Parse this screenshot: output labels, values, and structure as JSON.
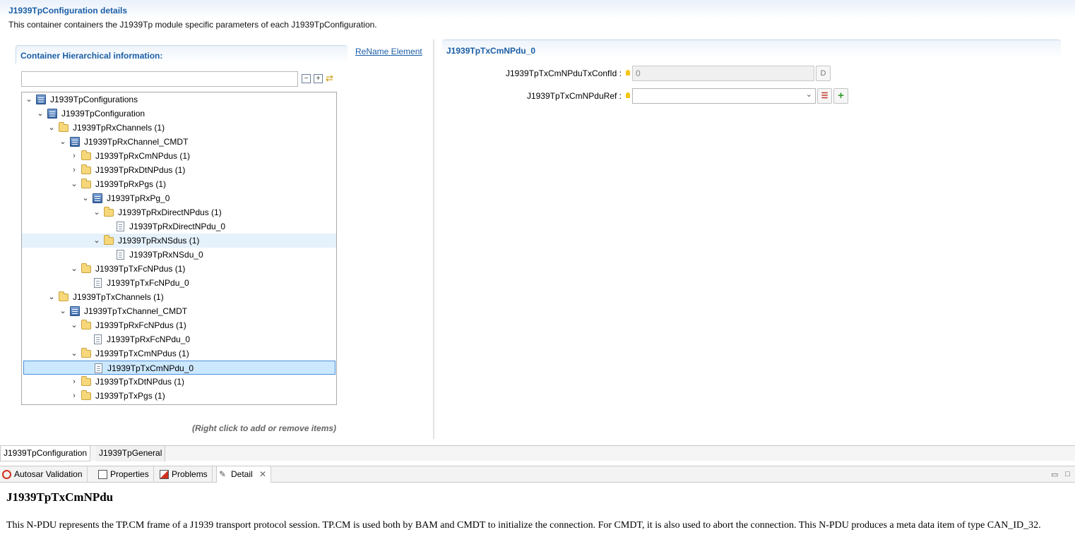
{
  "header": {
    "title": "J1939TpConfiguration details",
    "description": "This container containers the J1939Tp module specific parameters of each J1939TpConfiguration."
  },
  "left_panel": {
    "title": "Container Hierarchical information:",
    "rename_link": "ReName Element",
    "filter_value": "",
    "hint": "(Right click to add or remove items)"
  },
  "tree": [
    {
      "label": "J1939TpConfigurations",
      "icon": "config-icon",
      "twisty": "expanded"
    },
    {
      "label": "J1939TpConfiguration",
      "icon": "config-icon",
      "twisty": "expanded"
    },
    {
      "label": "J1939TpRxChannels (1)",
      "icon": "folder-icon",
      "twisty": "expanded"
    },
    {
      "label": "J1939TpRxChannel_CMDT",
      "icon": "config-icon",
      "twisty": "expanded"
    },
    {
      "label": "J1939TpRxCmNPdus (1)",
      "icon": "folder-icon",
      "twisty": "collapsed"
    },
    {
      "label": "J1939TpRxDtNPdus (1)",
      "icon": "folder-icon",
      "twisty": "collapsed"
    },
    {
      "label": "J1939TpRxPgs (1)",
      "icon": "folder-icon",
      "twisty": "expanded"
    },
    {
      "label": "J1939TpRxPg_0",
      "icon": "config-icon",
      "twisty": "expanded"
    },
    {
      "label": "J1939TpRxDirectNPdus (1)",
      "icon": "folder-icon",
      "twisty": "expanded"
    },
    {
      "label": "J1939TpRxDirectNPdu_0",
      "icon": "document-icon",
      "twisty": "none"
    },
    {
      "label": "J1939TpRxNSdus (1)",
      "icon": "folder-icon",
      "twisty": "expanded"
    },
    {
      "label": "J1939TpRxNSdu_0",
      "icon": "document-icon",
      "twisty": "none"
    },
    {
      "label": "J1939TpTxFcNPdus (1)",
      "icon": "folder-icon",
      "twisty": "expanded"
    },
    {
      "label": "J1939TpTxFcNPdu_0",
      "icon": "document-icon",
      "twisty": "none"
    },
    {
      "label": "J1939TpTxChannels (1)",
      "icon": "folder-icon",
      "twisty": "expanded"
    },
    {
      "label": "J1939TpTxChannel_CMDT",
      "icon": "config-icon",
      "twisty": "expanded"
    },
    {
      "label": "J1939TpRxFcNPdus (1)",
      "icon": "folder-icon",
      "twisty": "expanded"
    },
    {
      "label": "J1939TpRxFcNPdu_0",
      "icon": "document-icon",
      "twisty": "none"
    },
    {
      "label": "J1939TpTxCmNPdus (1)",
      "icon": "folder-icon",
      "twisty": "expanded"
    },
    {
      "label": "J1939TpTxCmNPdu_0",
      "icon": "document-icon",
      "twisty": "none"
    },
    {
      "label": "J1939TpTxDtNPdus (1)",
      "icon": "folder-icon",
      "twisty": "collapsed"
    },
    {
      "label": "J1939TpTxPgs (1)",
      "icon": "folder-icon",
      "twisty": "collapsed"
    }
  ],
  "right_panel": {
    "title": "J1939TpTxCmNPdu_0",
    "fields": [
      {
        "label": "J1939TpTxCmNPduTxConfId :",
        "value": "0",
        "button": "D"
      },
      {
        "label": "J1939TpTxCmNPduRef :",
        "value": ""
      }
    ]
  },
  "editor_tabs": [
    "J1939TpConfiguration",
    "J1939TpGeneral"
  ],
  "view_tabs": [
    "Autosar Validation",
    "Properties",
    "Problems",
    "Detail"
  ],
  "detail": {
    "title": "J1939TpTxCmNPdu",
    "body": "This N-PDU represents the TP.CM frame of a J1939 transport protocol session. TP.CM is used both by BAM and CMDT to initialize the connection. For CMDT, it is also used to abort the connection. This N-PDU produces a meta data item of type CAN_ID_32."
  },
  "colors": {
    "accent": "#1a5ea6",
    "selection": "#cce8ff",
    "hover": "#e5f1fb"
  }
}
